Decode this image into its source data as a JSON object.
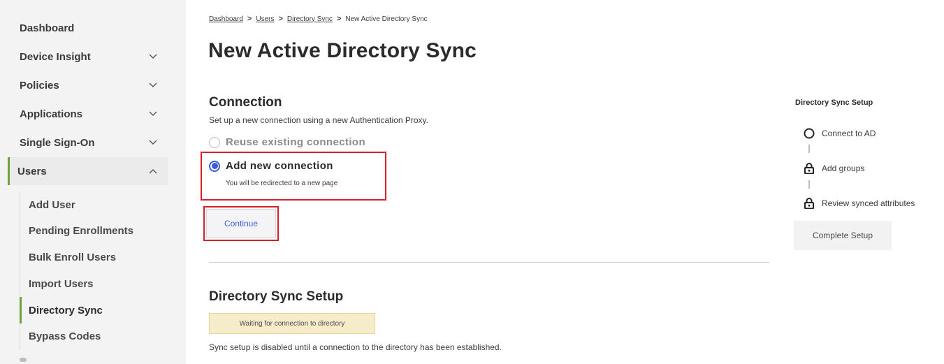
{
  "sidebar": {
    "items": [
      {
        "label": "Dashboard"
      },
      {
        "label": "Device Insight"
      },
      {
        "label": "Policies"
      },
      {
        "label": "Applications"
      },
      {
        "label": "Single Sign-On"
      },
      {
        "label": "Users"
      }
    ],
    "users_sub": [
      {
        "label": "Add User"
      },
      {
        "label": "Pending Enrollments"
      },
      {
        "label": "Bulk Enroll Users"
      },
      {
        "label": "Import Users"
      },
      {
        "label": "Directory Sync"
      },
      {
        "label": "Bypass Codes"
      }
    ],
    "accent_color": "#6ba539"
  },
  "breadcrumb": {
    "items": [
      "Dashboard",
      "Users",
      "Directory Sync"
    ],
    "current": "New Active Directory Sync",
    "separator": ">"
  },
  "page_title": "New Active Directory Sync",
  "connection": {
    "title": "Connection",
    "description": "Set up a new connection using a new Authentication Proxy.",
    "options": [
      {
        "label": "Reuse existing connection",
        "selected": false
      },
      {
        "label": "Add new connection",
        "selected": true,
        "sub": "You will be redirected to a new page"
      }
    ],
    "continue_label": "Continue"
  },
  "sync_setup": {
    "title": "Directory Sync Setup",
    "status": "Waiting for connection to directory",
    "note": "Sync setup is disabled until a connection to the directory has been established."
  },
  "right_panel": {
    "title": "Directory Sync Setup",
    "steps": [
      {
        "label": "Connect to AD",
        "icon": "circle-icon"
      },
      {
        "label": "Add groups",
        "icon": "lock-icon"
      },
      {
        "label": "Review synced attributes",
        "icon": "lock-icon"
      }
    ],
    "button_label": "Complete Setup"
  },
  "colors": {
    "link_blue": "#3b5bdb",
    "highlight_red": "#d4202a",
    "status_bg": "#f6ecc9"
  }
}
